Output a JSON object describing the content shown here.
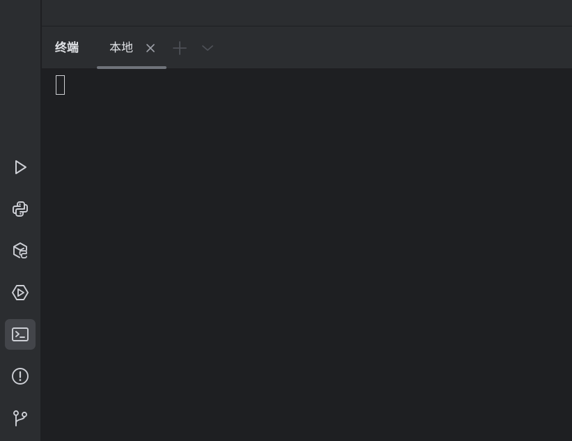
{
  "panel": {
    "title": "终端"
  },
  "tabs": [
    {
      "label": "本地",
      "active": true
    }
  ],
  "tab_actions": {
    "close_icon": "close-icon",
    "new_tab_icon": "plus-icon",
    "dropdown_icon": "chevron-down-icon"
  },
  "sidebar": {
    "items": [
      {
        "icon": "run-icon",
        "active": false
      },
      {
        "icon": "python-console-icon",
        "active": false
      },
      {
        "icon": "python-packages-icon",
        "active": false
      },
      {
        "icon": "services-icon",
        "active": false
      },
      {
        "icon": "terminal-icon",
        "active": true
      },
      {
        "icon": "problems-icon",
        "active": false
      },
      {
        "icon": "git-icon",
        "active": false
      }
    ]
  },
  "terminal": {
    "content": ""
  },
  "colors": {
    "background": "#1e1f22",
    "panel": "#2b2d30",
    "text": "#dfe1e5",
    "icon": "#ced0d6",
    "muted": "#6f737a",
    "active_button": "#43454a"
  }
}
